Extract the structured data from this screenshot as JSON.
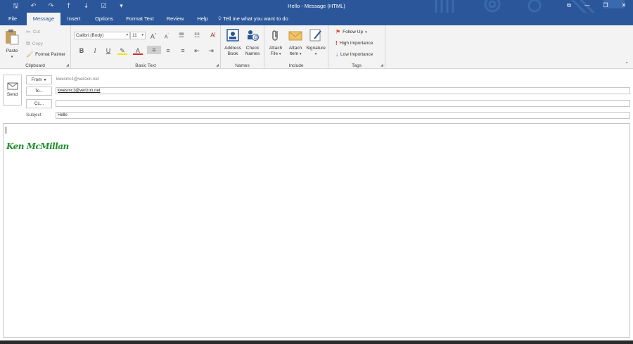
{
  "window": {
    "title": "Hello  -  Message (HTML)"
  },
  "qat": {
    "save": "🖫",
    "undo": "↶",
    "redo": "↷",
    "up": "↑",
    "down": "↓",
    "check": "☑",
    "more": "▾"
  },
  "window_controls": {
    "ribbon_display": "⧉",
    "minimize": "—",
    "restore": "❐",
    "close": "✕"
  },
  "tabs": [
    "File",
    "Message",
    "Insert",
    "Options",
    "Format Text",
    "Review",
    "Help"
  ],
  "tell_me": "Tell me what you want to do",
  "ribbon": {
    "clipboard": {
      "label": "Clipboard",
      "paste": "Paste",
      "cut": "Cut",
      "copy": "Copy",
      "format_painter": "Format Painter"
    },
    "basic_text": {
      "label": "Basic Text",
      "font": "Calibri (Body)",
      "size": "11"
    },
    "names": {
      "label": "Names",
      "address_book_1": "Address",
      "address_book_2": "Book",
      "check_names_1": "Check",
      "check_names_2": "Names"
    },
    "include": {
      "label": "Include",
      "attach_file_1": "Attach",
      "attach_file_2": "File",
      "attach_item_1": "Attach",
      "attach_item_2": "Item",
      "signature": "Signature"
    },
    "tags": {
      "label": "Tags",
      "follow_up": "Follow Up",
      "high_importance": "High Importance",
      "low_importance": "Low Importance"
    }
  },
  "compose": {
    "send": "Send",
    "from_btn": "From",
    "from_value": "kwesmc1@verizon.net",
    "to_btn": "To...",
    "to_value": "kwesmc1@verizon.net",
    "cc_btn": "Cc...",
    "cc_value": "",
    "subject_label": "Subject",
    "subject_value": "Hello"
  },
  "body": {
    "signature": "Ken McMillan"
  },
  "colors": {
    "accent": "#2b579a",
    "ribbon_bg": "#f3f3f3",
    "signature": "#1f8f2c"
  }
}
